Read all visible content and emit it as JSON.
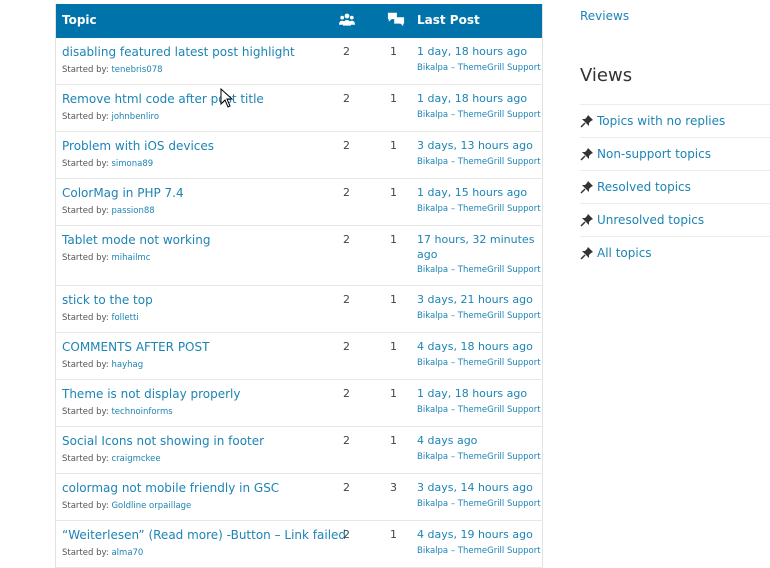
{
  "table": {
    "header": {
      "topic": "Topic",
      "voices_icon": "users-icon",
      "posts_icon": "speech-bubbles-icon",
      "last_post": "Last Post"
    },
    "rows": [
      {
        "title": "disabling featured latest post highlight",
        "started_label": "Started by:",
        "author": "tenebris078",
        "voices": "2",
        "posts": "1",
        "freshness": "1 day, 18 hours ago",
        "last_author": "Bikalpa – ThemeGrill Support"
      },
      {
        "title": "Remove html code after post title",
        "started_label": "Started by:",
        "author": "johnbenliro",
        "voices": "2",
        "posts": "1",
        "freshness": "1 day, 18 hours ago",
        "last_author": "Bikalpa – ThemeGrill Support"
      },
      {
        "title": "Problem with iOS devices",
        "started_label": "Started by:",
        "author": "simona89",
        "voices": "2",
        "posts": "1",
        "freshness": "3 days, 13 hours ago",
        "last_author": "Bikalpa – ThemeGrill Support"
      },
      {
        "title": "ColorMag in PHP 7.4",
        "started_label": "Started by:",
        "author": "passion88",
        "voices": "2",
        "posts": "1",
        "freshness": "1 day, 15 hours ago",
        "last_author": "Bikalpa – ThemeGrill Support"
      },
      {
        "title": "Tablet mode not working",
        "started_label": "Started by:",
        "author": "mihailmc",
        "voices": "2",
        "posts": "1",
        "freshness": "17 hours, 32 minutes ago",
        "last_author": "Bikalpa – ThemeGrill Support"
      },
      {
        "title": "stick to the top",
        "started_label": "Started by:",
        "author": "folletti",
        "voices": "2",
        "posts": "1",
        "freshness": "3 days, 21 hours ago",
        "last_author": "Bikalpa – ThemeGrill Support"
      },
      {
        "title": "COMMENTS AFTER POST",
        "started_label": "Started by:",
        "author": "hayhag",
        "voices": "2",
        "posts": "1",
        "freshness": "4 days, 18 hours ago",
        "last_author": "Bikalpa – ThemeGrill Support"
      },
      {
        "title": "Theme is not display properly",
        "started_label": "Started by:",
        "author": "technoinforms",
        "voices": "2",
        "posts": "1",
        "freshness": "1 day, 18 hours ago",
        "last_author": "Bikalpa – ThemeGrill Support"
      },
      {
        "title": "Social Icons not showing in footer",
        "started_label": "Started by:",
        "author": "craigmckee",
        "voices": "2",
        "posts": "1",
        "freshness": "4 days ago",
        "last_author": "Bikalpa – ThemeGrill Support"
      },
      {
        "title": "colormag not mobile friendly in GSC",
        "started_label": "Started by:",
        "author": "Goldline orpaillage",
        "voices": "2",
        "posts": "3",
        "freshness": "3 days, 14 hours ago",
        "last_author": "Bikalpa – ThemeGrill Support"
      },
      {
        "title": "“Weiterlesen” (Read more) -Button – Link failed",
        "started_label": "Started by:",
        "author": "alma70",
        "voices": "2",
        "posts": "1",
        "freshness": "4 days, 19 hours ago",
        "last_author": "Bikalpa – ThemeGrill Support"
      }
    ]
  },
  "sidebar": {
    "reviews_link": "Reviews",
    "views_title": "Views",
    "views": [
      {
        "label": "Topics with no replies",
        "icon": "pin-icon"
      },
      {
        "label": "Non-support topics",
        "icon": "pin-icon"
      },
      {
        "label": "Resolved topics",
        "icon": "pin-icon"
      },
      {
        "label": "Unresolved topics",
        "icon": "pin-icon"
      },
      {
        "label": "All topics",
        "icon": "pin-icon"
      }
    ]
  },
  "colors": {
    "header_bg": "#0073aa",
    "link": "#1d84b5"
  }
}
